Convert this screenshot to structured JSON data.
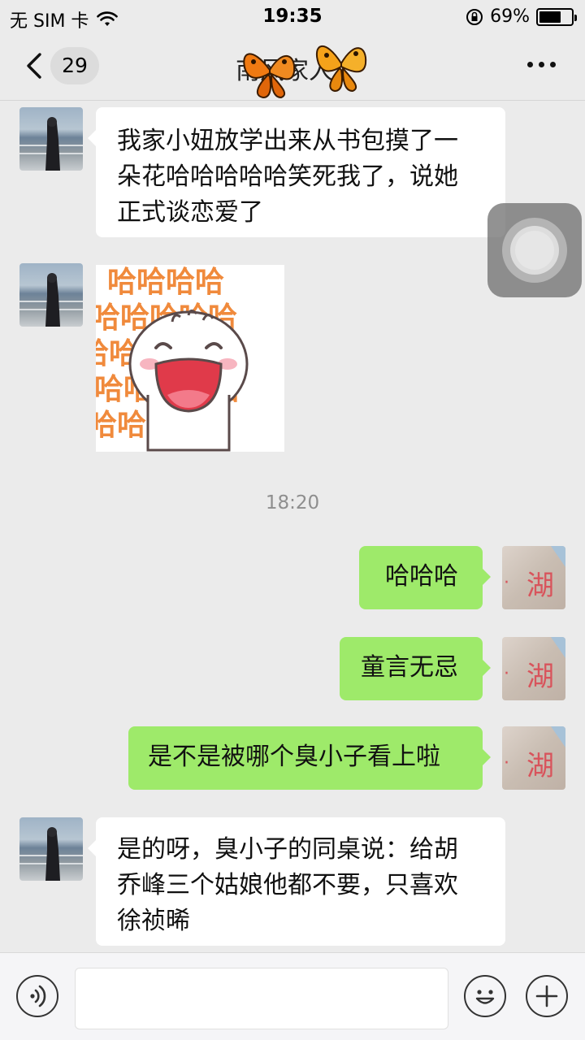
{
  "status_bar": {
    "carrier": "无 SIM 卡",
    "time": "19:35",
    "battery": "69%",
    "battery_level": 0.69
  },
  "nav": {
    "unread_count": "29",
    "title": "南风家人"
  },
  "messages": [
    {
      "side": "in",
      "text_lines": [
        "我家小妞放学出来从书包摸了一",
        "朵花哈哈哈哈哈笑死我了，说她",
        "正式谈恋爱了"
      ]
    },
    {
      "side": "in",
      "type": "sticker",
      "sticker_text": [
        "哈哈哈哈",
        "哈哈哈哈哈",
        "哈哈哈哈哈",
        "哈哈哈哈哈",
        "哈哈哈哈"
      ]
    },
    {
      "side": "out",
      "text": "哈哈哈"
    },
    {
      "side": "out",
      "text": "童言无忌"
    },
    {
      "side": "out",
      "text": "是不是被哪个臭小子看上啦"
    },
    {
      "side": "in",
      "text_lines": [
        "是的呀，臭小子的同桌说：给胡",
        "乔峰三个姑娘他都不要，只喜欢",
        "徐祯晞"
      ]
    }
  ],
  "timestamp": "18:20",
  "avatar_right_text": "湖",
  "input_bar": {
    "value": "",
    "icons": [
      "voice-icon",
      "emoji-icon",
      "plus-icon"
    ]
  },
  "colors": {
    "background": "#ebebeb",
    "bubble_out": "#9eea6a",
    "bubble_in": "#ffffff",
    "sticker_text": "#f08a3c"
  }
}
